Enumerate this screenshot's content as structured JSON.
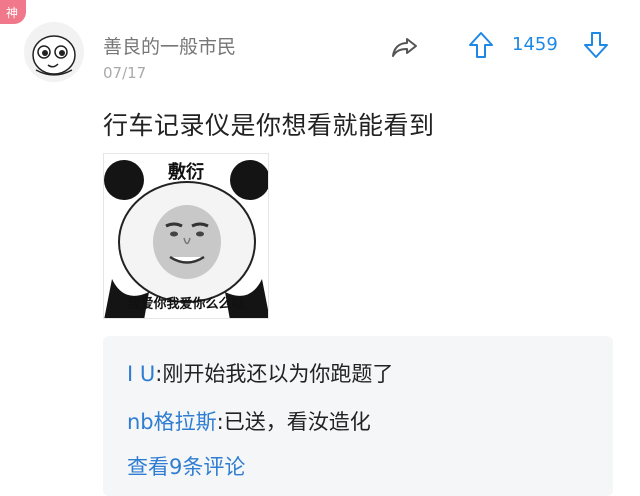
{
  "badge": {
    "label": "神",
    "color": "#f0788a"
  },
  "post": {
    "username": "善良的一般市民",
    "date": "07/17",
    "vote_count": "1459",
    "text": "行车记录仪是你想看就能看到",
    "meme": {
      "top_text": "敷衍",
      "bottom_text": "我爱你我爱你么么哒"
    }
  },
  "icons": {
    "share": "share-icon",
    "upvote": "arrow-up-icon",
    "downvote": "arrow-down-icon"
  },
  "comments": {
    "items": [
      {
        "author": "I  U",
        "separator": ":",
        "text": "刚开始我还以为你跑题了"
      },
      {
        "author": "nb格拉斯",
        "separator": ":",
        "text": "已送，看汝造化"
      }
    ],
    "more_label": "查看9条评论"
  },
  "colors": {
    "accent": "#1e88e5",
    "link": "#2f7dd1",
    "comment_bg": "#f5f6f8"
  }
}
